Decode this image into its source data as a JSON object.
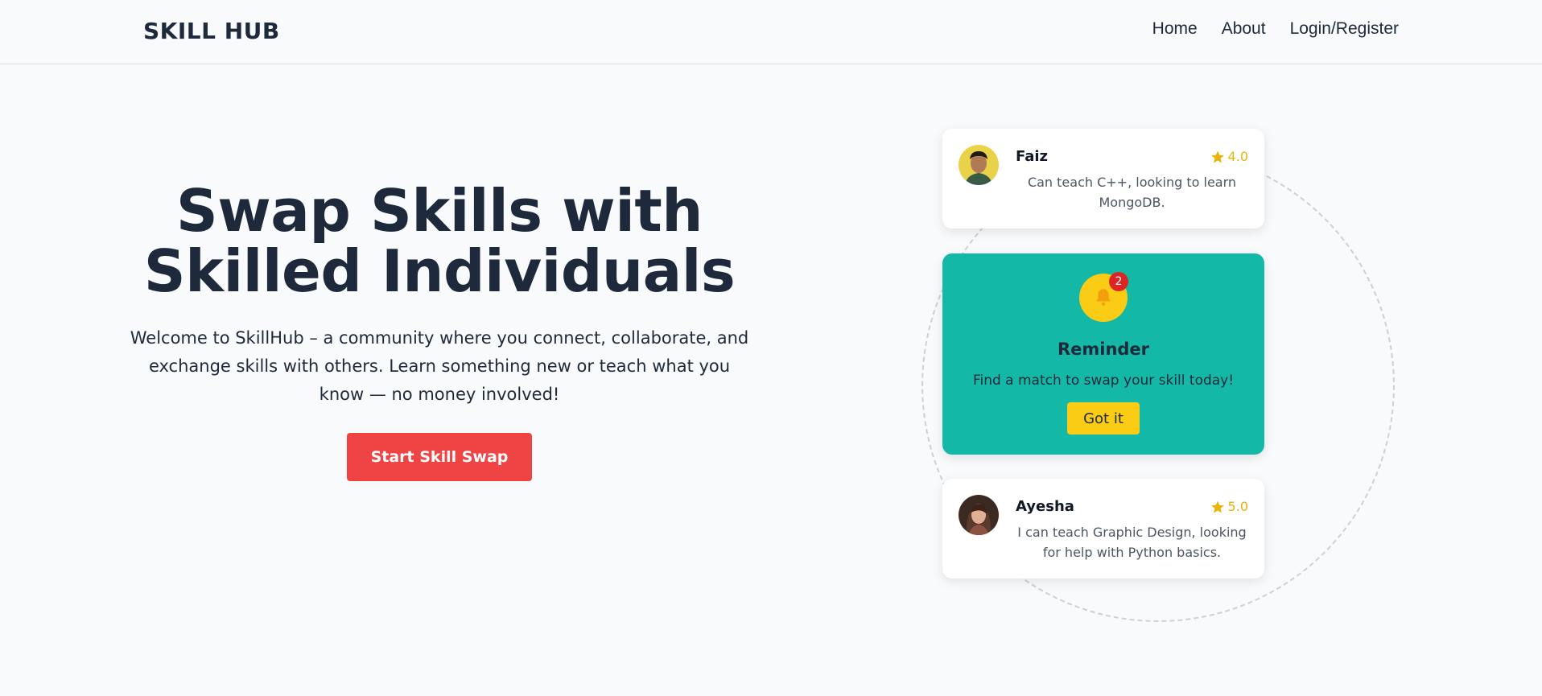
{
  "nav": {
    "logo": "SKILL HUB",
    "links": [
      "Home",
      "About",
      "Login/Register"
    ]
  },
  "hero": {
    "title_line1": "Swap Skills with",
    "title_line2": "Skilled Individuals",
    "description": "Welcome to SkillHub – a community where you connect, collaborate, and exchange skills with others. Learn something new or teach what you know — no money involved!",
    "cta_label": "Start Skill Swap"
  },
  "cards": [
    {
      "name": "Faiz",
      "rating": "4.0",
      "description": "Can teach C++, looking to learn MongoDB."
    },
    {
      "name": "Ayesha",
      "rating": "5.0",
      "description": "I can teach Graphic Design, looking for help with Python basics."
    }
  ],
  "reminder": {
    "badge_count": "2",
    "title": "Reminder",
    "text": "Find a match to swap your skill today!",
    "button_label": "Got it"
  },
  "colors": {
    "accent_red": "#ef4444",
    "teal": "#14b8a6",
    "yellow": "#facc15",
    "star": "#eab308"
  }
}
